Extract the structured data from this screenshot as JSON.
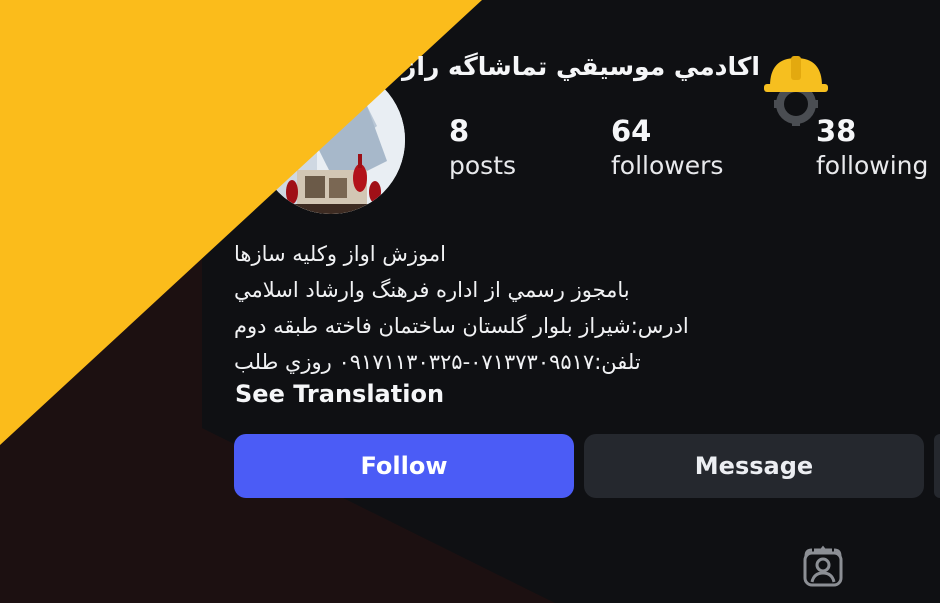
{
  "profile": {
    "name": "اكادمي موسيقي تماشاگه راز",
    "badge_icon": "hardhat-gear-icon",
    "stats": [
      {
        "value": "8",
        "label": "posts"
      },
      {
        "value": "64",
        "label": "followers"
      },
      {
        "value": "38",
        "label": "following"
      }
    ],
    "bio_lines": [
      "اموزش اواز وكليه سازها",
      "بامجوز رسمي از اداره فرهنگ وارشاد اسلامي",
      "ادرس:شيراز بلوار گلستان ساختمان فاخته طبقه دوم",
      "تلفن:۰۷۱۳۷۳۰۹۵۱۷-۰۹۱۷۱۱۳۰۳۲۵ روزي طلب"
    ],
    "see_translation": "See Translation"
  },
  "actions": {
    "follow_label": "Follow",
    "message_label": "Message"
  },
  "tabs": {
    "tagged_icon": "tagged-person-icon"
  },
  "colors": {
    "background": "#0f1013",
    "accent_yellow": "#fbbc1b",
    "overlay_dark_red": "#1c1011",
    "follow_button": "#4b5cf6",
    "message_button": "#25282e"
  }
}
